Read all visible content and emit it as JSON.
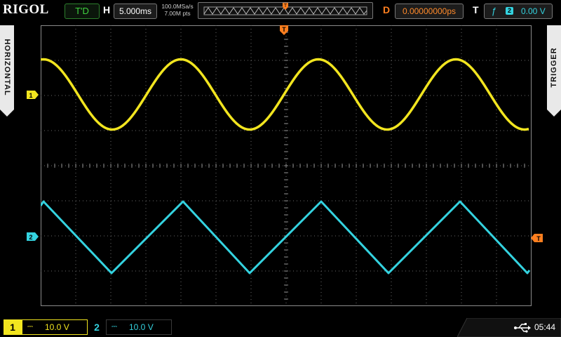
{
  "brand": "RIGOL",
  "run_status": "T'D",
  "horizontal": {
    "label": "H",
    "timebase": "5.000ms",
    "sample_rate": "100.0MSa/s",
    "memory_depth": "7.00M pts"
  },
  "delay": {
    "label": "D",
    "value": "0.00000000ps"
  },
  "trigger": {
    "label": "T",
    "edge_glyph": "ƒ",
    "source": "2",
    "level": "0.00 V"
  },
  "side_tabs": {
    "left": "HORIZONTAL",
    "right": "TRIGGER"
  },
  "markers": {
    "ch1": "1",
    "ch2": "2",
    "trigger_level": "T",
    "trigger_position": "T"
  },
  "channels": [
    {
      "number": "1",
      "coupling": "⎓",
      "scale": "10.0 V",
      "color": "#f2e51f"
    },
    {
      "number": "2",
      "coupling": "⎓",
      "scale": "10.0 V",
      "color": "#34d3e0"
    }
  ],
  "status": {
    "usb_icon": "usb-icon",
    "time": "05:44"
  },
  "colors": {
    "ch1": "#f2e51f",
    "ch2": "#34d3e0",
    "trigger": "#ff7f1f",
    "grid": "#6a6a6a",
    "run": "#3fd23f"
  }
}
